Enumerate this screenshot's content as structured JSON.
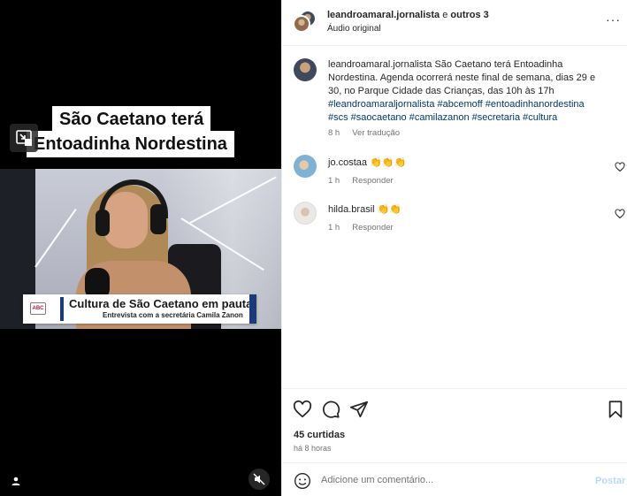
{
  "video": {
    "headline_line1": "São Caetano terá",
    "headline_line2": "Entoadinha Nordestina",
    "lower_third_title": "Cultura de São Caetano em pauta",
    "lower_third_subtitle": "Entrevista com a secretária Camila Zanon",
    "logo_text": "ABC"
  },
  "header": {
    "username": "leandroamaral.jornalista",
    "separator": " e ",
    "collaborators": "outros 3",
    "audio": "Áudio original",
    "more": "···"
  },
  "caption": {
    "username": "leandroamaral.jornalista",
    "text": " São Caetano terá Entoadinha Nordestina. Agenda ocorrerá neste final de semana, dias 29 e 30, no Parque Cidade das Crianças, das 10h às 17h ",
    "hashtags": "#leandroamaraljornalista #abcemoff #entoadinhanordestina #scs #saocaetano #camilazanon #secretaria #cultura",
    "time": "8 h",
    "translate": "Ver tradução"
  },
  "comments": [
    {
      "username": "jo.costaa",
      "text": " 👏👏👏",
      "time": "1 h",
      "reply": "Responder"
    },
    {
      "username": "hilda.brasil",
      "text": " 👏👏",
      "time": "1 h",
      "reply": "Responder"
    }
  ],
  "actions": {
    "likes": "45 curtidas",
    "ago": "há 8 horas"
  },
  "add_comment": {
    "placeholder": "Adicione um comentário...",
    "post": "Postar"
  },
  "colors": {
    "link": "#00376b",
    "muted": "#737373",
    "post_disabled": "#b3dbff",
    "lower_third_accent": "#1b3a78"
  }
}
